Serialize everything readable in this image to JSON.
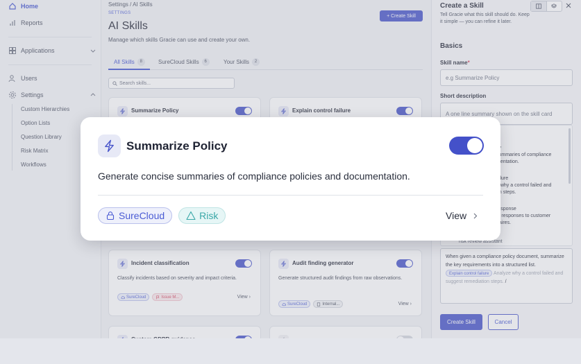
{
  "sidebar": {
    "home": "Home",
    "reports": "Reports",
    "applications": "Applications",
    "users": "Users",
    "settings": "Settings",
    "sub_items": [
      "Custom Hierarchies",
      "Option Lists",
      "Question Library",
      "Risk Matrix",
      "Workflows"
    ]
  },
  "main": {
    "breadcrumb": "Settings  /  AI Skills",
    "overline": "SETTINGS",
    "title": "AI Skills",
    "subtitle": "Manage which skills Gracie can use and create your own.",
    "create_button": "+ Create Skill",
    "tabs": [
      {
        "label": "All Skills",
        "count": "8"
      },
      {
        "label": "SureCloud Skills",
        "count": "6"
      },
      {
        "label": "Your Skills",
        "count": "2"
      }
    ],
    "search_placeholder": "Search skills...",
    "cards": [
      {
        "title": "Summarize Policy",
        "enabled": true
      },
      {
        "title": "Explain control failure",
        "enabled": true
      },
      {
        "title": "Incident classification",
        "enabled": true,
        "description": "Classify incidents based on severity and impact criteria.",
        "tags": [
          "SureCloud",
          "Issue M..."
        ],
        "view": "View"
      },
      {
        "title": "Audit finding generator",
        "enabled": true,
        "description": "Generate structured audit findings from raw observations.",
        "tags": [
          "SureCloud",
          "Internal..."
        ],
        "view": "View"
      },
      {
        "title": "Custom GDPR guidance",
        "enabled": true
      },
      {
        "title": "",
        "enabled": false
      }
    ]
  },
  "panel": {
    "title": "Create a Skill",
    "subtitle": "Tell Gracie what this skill should do. Keep it simple — you can refine it later.",
    "section": "Basics",
    "skill_name_label": "Skill name",
    "skill_name_required": "*",
    "skill_name_placeholder": "e.g Summarize Policy",
    "short_desc_label": "Short description",
    "short_desc_placeholder": "A one line summary shown on the skill card",
    "dropdown_fragments": [
      {
        "title": "cy",
        "line1": "summaries of compliance",
        "line2": "mentation."
      },
      {
        "title": "ailure",
        "line1": "n why a control failed and",
        "line2": "on steps."
      },
      {
        "title": "response",
        "line1": "al responses to customer",
        "line2": "naires."
      }
    ],
    "dropdown_partial": "risk review assistant",
    "instructions_text": "When given a compliance policy document, summarize the key requirements into a structured list.",
    "instructions_chip": "Explain control failure",
    "instructions_ghost": "Analyze why a control failed and suggest remediation steps.",
    "create_button": "Create Skill",
    "cancel_button": "Cancel"
  },
  "focus_card": {
    "title": "Summarize Policy",
    "enabled": true,
    "description": "Generate concise summaries of compliance policies and documentation.",
    "tags": [
      {
        "label": "SureCloud",
        "icon": "lock-icon"
      },
      {
        "label": "Risk",
        "icon": "triangle-icon"
      }
    ],
    "view": "View"
  },
  "colors": {
    "accent": "#4451c9",
    "surecloud_tag": "#4a5bd4",
    "risk_tag": "#3aa8a8",
    "issue_tag": "#d4455e"
  }
}
